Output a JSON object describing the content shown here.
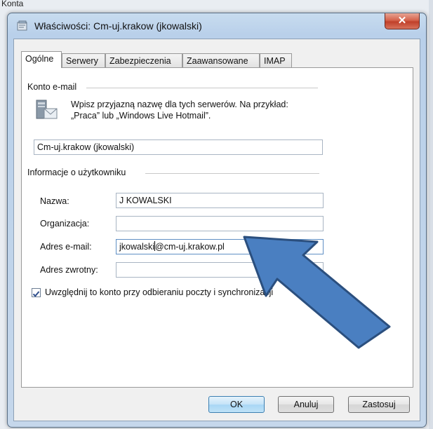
{
  "background": {
    "left_text": "Konta"
  },
  "window": {
    "title": "Właściwości: Cm-uj.krakow (jkowalski)",
    "close_glyph": "✕"
  },
  "tabs": [
    {
      "label": "Ogólne",
      "active": true
    },
    {
      "label": "Serwery",
      "active": false
    },
    {
      "label": "Zabezpieczenia",
      "active": false
    },
    {
      "label": "Zaawansowane",
      "active": false
    },
    {
      "label": "IMAP",
      "active": false
    }
  ],
  "account": {
    "group_label": "Konto e-mail",
    "info_line1": "Wpisz przyjazną nazwę dla tych serwerów. Na przykład:",
    "info_line2": "„Praca” lub „Windows Live Hotmail”.",
    "account_name": "Cm-uj.krakow (jkowalski)"
  },
  "user": {
    "group_label": "Informacje o użytkowniku",
    "name_label": "Nazwa:",
    "name_value": "J KOWALSKI",
    "org_label": "Organizacja:",
    "org_value": "",
    "email_label": "Adres e-mail:",
    "email_value_before": "jkowalski",
    "email_value_after": "@cm-uj.krakow.pl",
    "reply_label": "Adres zwrotny:",
    "reply_value": ""
  },
  "include_checkbox": {
    "label": "Uwzględnij to konto przy odbieraniu poczty i synchronizacji",
    "checked": true
  },
  "buttons": {
    "ok": "OK",
    "cancel": "Anuluj",
    "apply": "Zastosuj"
  },
  "colors": {
    "arrow_fill": "#4a7fc1",
    "arrow_stroke": "#2b4f7e",
    "titlebar": "#c6dbef",
    "close_button": "#c9483a"
  },
  "icons": {
    "title": "mail-account-icon",
    "info": "monitor-mail-icon",
    "checkmark": "checkmark-icon",
    "close": "close-icon"
  }
}
